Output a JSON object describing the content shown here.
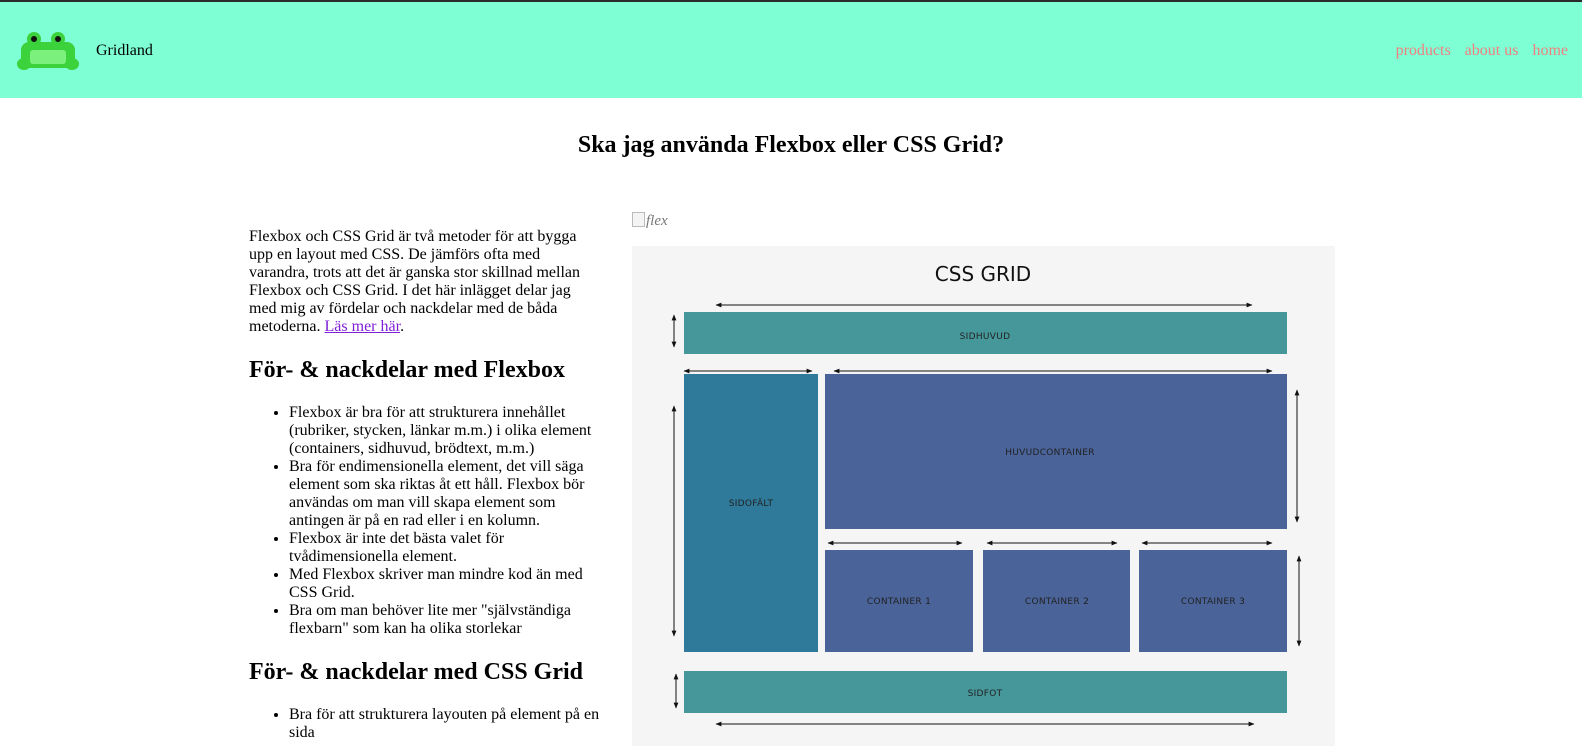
{
  "header": {
    "brand": "Gridland",
    "nav": [
      {
        "label": "products"
      },
      {
        "label": "about us"
      },
      {
        "label": "home"
      }
    ],
    "colors": {
      "background": "#7fffd4",
      "link": "#f08080"
    }
  },
  "page": {
    "title": "Ska jag använda Flexbox eller CSS Grid?"
  },
  "intro": {
    "text": "Flexbox och CSS Grid är två metoder för att bygga upp en layout med CSS. De jämförs ofta med varandra, trots att det är ganska stor skillnad mellan Flexbox och CSS Grid. I det här inlägget delar jag med mig av fördelar och nackdelar med de båda metoderna. ",
    "link_label": "Läs mer här",
    "after_link": "."
  },
  "flexbox_section": {
    "heading": "För- & nackdelar med Flexbox",
    "items": [
      "Flexbox är bra för att strukturera innehållet (rubriker, stycken, länkar m.m.) i olika element (containers, sidhuvud, brödtext, m.m.)",
      "Bra för endimensionella element, det vill säga element som ska riktas åt ett håll. Flexbox bör användas om man vill skapa element som antingen är på en rad eller i en kolumn.",
      "Flexbox är inte det bästa valet för tvådimensionella element.",
      "Med Flexbox skriver man mindre kod än med CSS Grid.",
      "Bra om man behöver lite mer \"självständiga flexbarn\" som kan ha olika storlekar"
    ]
  },
  "grid_section": {
    "heading": "För- & nackdelar med CSS Grid",
    "items": [
      "Bra för att strukturera layouten på element på en sida"
    ]
  },
  "broken_image": {
    "alt": "flex"
  },
  "diagram": {
    "title": "CSS GRID",
    "labels": {
      "header": "SIDHUVUD",
      "sidebar": "SIDOFÄLT",
      "main": "HUVUDCONTAINER",
      "c1": "CONTAINER 1",
      "c2": "CONTAINER 2",
      "c3": "CONTAINER 3",
      "footer": "SIDFOT"
    },
    "colors": {
      "teal": "#46979a",
      "sidebar": "#2f7a9a",
      "blue": "#4a6399",
      "background": "#f5f5f5"
    }
  }
}
